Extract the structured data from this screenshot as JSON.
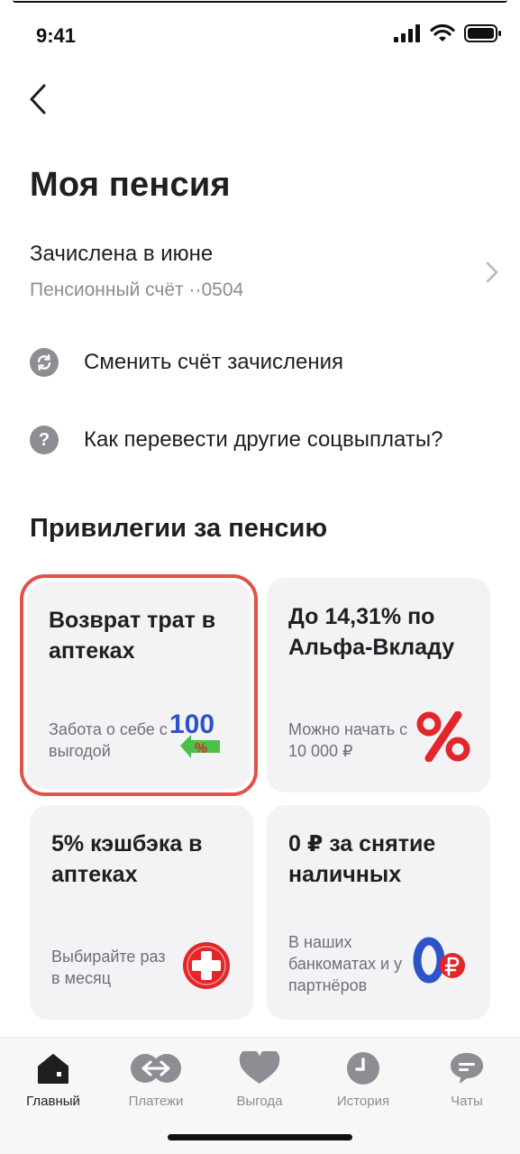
{
  "status": {
    "time": "9:41"
  },
  "header": {
    "title": "Моя пенсия"
  },
  "account": {
    "title": "Зачислена в июне",
    "subtitle": "Пенсионный счёт ··0504"
  },
  "actions": [
    {
      "label": "Сменить счёт зачисления",
      "icon": "refresh-icon"
    },
    {
      "label": "Как перевести другие соцвыплаты?",
      "icon": "question-icon"
    }
  ],
  "privileges": {
    "title": "Привилегии за пенсию",
    "cards": [
      {
        "title": "Возврат трат в аптеках",
        "description": "Забота о себе с выгодой",
        "icon": "cashback-100-percent-icon",
        "highlighted": true
      },
      {
        "title": "До 14,31% по Альфа-Вкладу",
        "description": "Можно начать с 10 000 ₽",
        "icon": "percent-icon"
      },
      {
        "title": "5% кэшбэка в аптеках",
        "description": "Выбирайте раз в месяц",
        "icon": "pharmacy-cross-icon"
      },
      {
        "title": "0 ₽ за снятие наличных",
        "description": "В наших банкоматах и у партнёров",
        "icon": "zero-ruble-icon"
      }
    ]
  },
  "tabs": [
    {
      "label": "Главный",
      "icon": "home-icon",
      "active": true
    },
    {
      "label": "Платежи",
      "icon": "transfer-icon"
    },
    {
      "label": "Выгода",
      "icon": "heart-icon"
    },
    {
      "label": "История",
      "icon": "clock-icon"
    },
    {
      "label": "Чаты",
      "icon": "chat-icon"
    }
  ],
  "colors": {
    "highlight": "#e0524a",
    "accent_red": "#e3262b",
    "card_bg": "#f3f3f5",
    "muted_text": "#8b8d93"
  }
}
